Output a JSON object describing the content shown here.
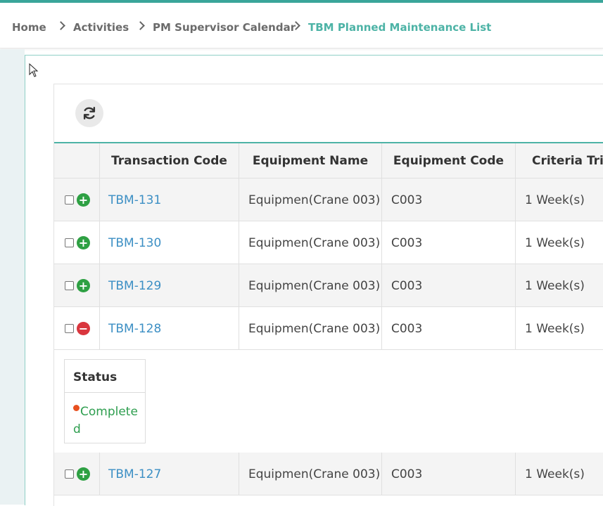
{
  "breadcrumb": {
    "items": [
      "Home",
      "Activities",
      "PM Supervisor Calendar"
    ],
    "current": "TBM Planned Maintenance List"
  },
  "toolbar": {
    "refresh_icon": "refresh-icon"
  },
  "table": {
    "columns": [
      "",
      "Transaction Code",
      "Equipment Name",
      "Equipment Code",
      "Criteria Trig"
    ],
    "rows": [
      {
        "code": "TBM-131",
        "equipment_name": "Equipmen(Crane 003)",
        "equipment_code": "C003",
        "criteria": "1 Week(s)",
        "expanded": false
      },
      {
        "code": "TBM-130",
        "equipment_name": "Equipmen(Crane 003)",
        "equipment_code": "C003",
        "criteria": "1 Week(s)",
        "expanded": false
      },
      {
        "code": "TBM-129",
        "equipment_name": "Equipmen(Crane 003)",
        "equipment_code": "C003",
        "criteria": "1 Week(s)",
        "expanded": false
      },
      {
        "code": "TBM-128",
        "equipment_name": "Equipmen(Crane 003)",
        "equipment_code": "C003",
        "criteria": "1 Week(s)",
        "expanded": true
      },
      {
        "code": "TBM-127",
        "equipment_name": "Equipmen(Crane 003)",
        "equipment_code": "C003",
        "criteria": "1 Week(s)",
        "expanded": false
      }
    ],
    "detail": {
      "status_label": "Status",
      "status_value": "Completed"
    }
  },
  "colors": {
    "accent": "#4db3a6",
    "link": "#3c8fc4",
    "plus": "#2ea043",
    "minus": "#d9363e",
    "status_green": "#2e9e4f",
    "status_dot": "#e8501f"
  }
}
